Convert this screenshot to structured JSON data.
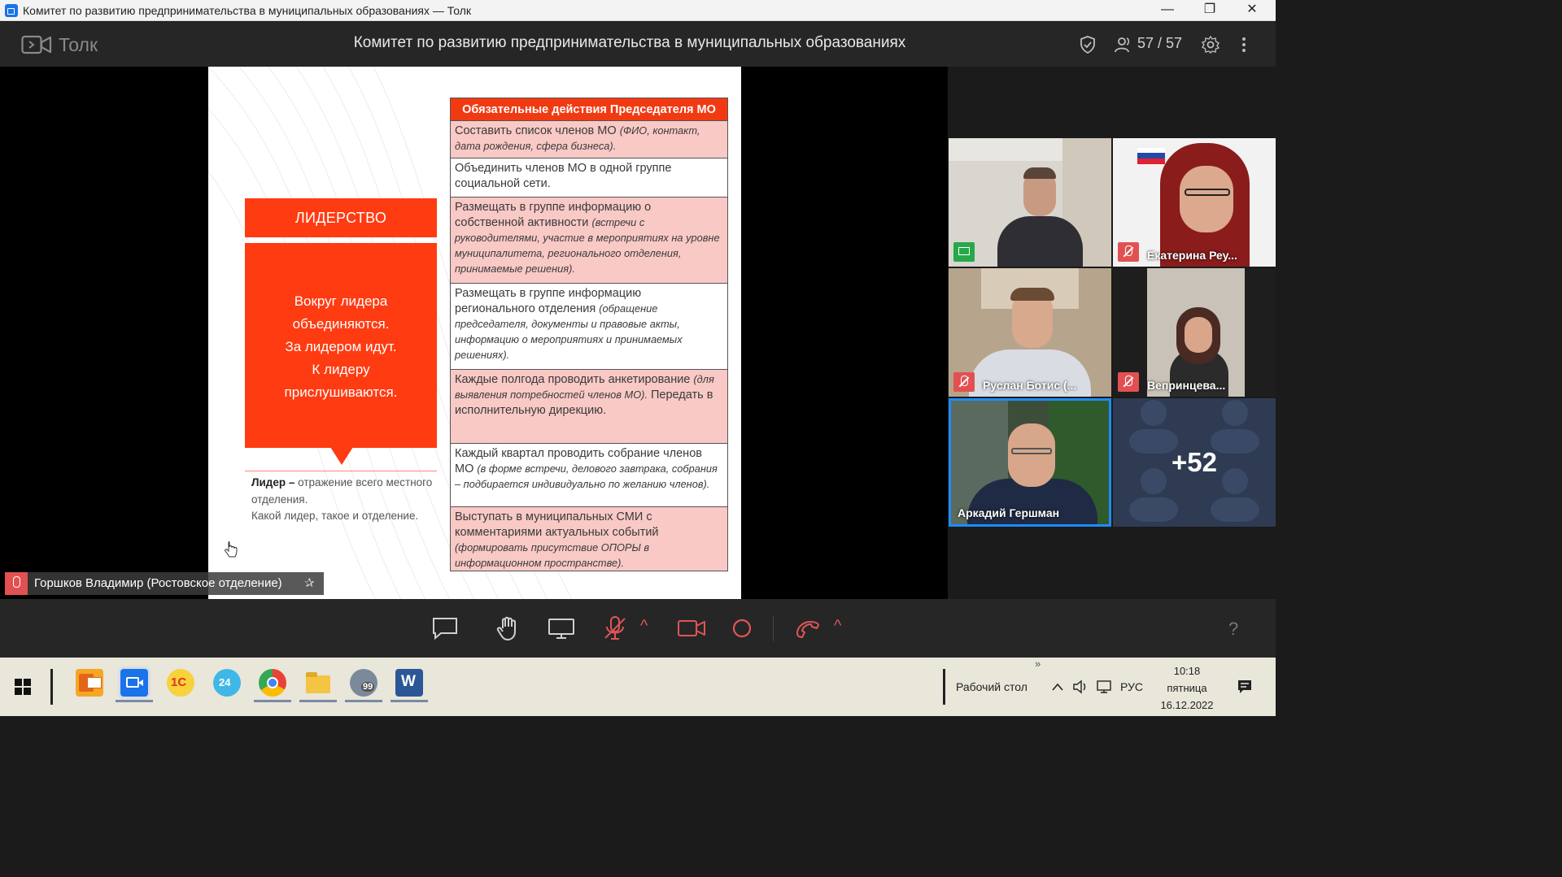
{
  "window": {
    "title": "Комитет по развитию предпринимательства в муниципальных образованиях — Толк",
    "minimize": "—",
    "restore": "❐",
    "close": "✕"
  },
  "app": {
    "name": "Толк",
    "meeting_title": "Комитет по развитию предпринимательства в муниципальных образованиях",
    "participants": "57 / 57",
    "accent": "#1a73e8"
  },
  "slide": {
    "leadership_title": "ЛИДЕРСТВО",
    "leadership_lines": [
      "Вокруг лидера",
      "объединяются.",
      "За лидером идут.",
      "К лидеру",
      "прислушиваются."
    ],
    "note_bold": "Лидер –",
    "note_rest": " отражение всего местного отделения.",
    "note_line2": "Какой лидер, такое и отделение.",
    "table_header": "Обязательные действия Председателя МО",
    "rows": [
      {
        "text": "Составить список членов МО ",
        "italic": "(ФИО, контакт, дата рождения, сфера бизнеса).",
        "after": ""
      },
      {
        "text": "Объединить членов МО в одной группе социальной сети.",
        "italic": "",
        "after": ""
      },
      {
        "text": "Размещать в группе информацию о собственной активности ",
        "italic": "(встречи с руководителями, участие в мероприятиях на уровне муниципалитета, регионального отделения, принимаемые решения).",
        "after": ""
      },
      {
        "text": "Размещать в группе информацию регионального отделения ",
        "italic": "(обращение председателя, документы и правовые акты, информацию о мероприятиях и принимаемых решениях).",
        "after": ""
      },
      {
        "text": "Каждые полгода проводить анкетирование ",
        "italic": "(для выявления потребностей членов МО).",
        "after": " Передать в исполнительную дирекцию."
      },
      {
        "text": "Каждый квартал проводить собрание членов МО ",
        "italic": "(в форме встречи, делового завтрака, собрания – подбирается индивидуально по желанию членов).",
        "after": ""
      },
      {
        "text": "Выступать в муниципальных СМИ с комментариями актуальных событий ",
        "italic": "(формировать присутствие ОПОРЫ в информационном пространстве).",
        "after": ""
      }
    ],
    "accent": "#ff3b12"
  },
  "tiles": [
    {
      "name": "",
      "badge": "screen"
    },
    {
      "name": "Екатерина Реу...",
      "badge": "muted"
    },
    {
      "name": "Руслан Ботис (...",
      "badge": "muted"
    },
    {
      "name": "Вепринцева...",
      "badge": "muted"
    },
    {
      "name": "Аркадий Гершман",
      "badge": "none",
      "active": true
    },
    {
      "name": "+52",
      "badge": "none"
    }
  ],
  "speaker": {
    "name": "Горшков Владимир (Ростовское отделение)",
    "pin": "✰"
  },
  "controls": {
    "help": "?",
    "chevron": "^"
  },
  "taskbar": {
    "desktop": "Рабочий стол",
    "lang": "РУС",
    "time": "10:18",
    "weekday": "пятница",
    "date": "16.12.2022",
    "overflow": "»",
    "badge_24": "24",
    "badge_99": "99",
    "app_1c": "1С",
    "app_word": "W"
  }
}
